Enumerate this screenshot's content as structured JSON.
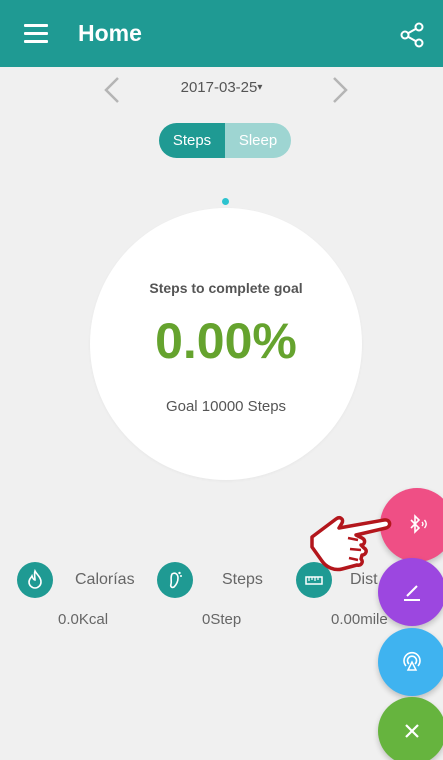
{
  "appbar": {
    "title": "Home",
    "menu_icon": "menu-icon",
    "share_icon": "share-icon"
  },
  "date": {
    "value": "2017-03-25",
    "caret": "▾"
  },
  "toggle": {
    "steps_label": "Steps",
    "sleep_label": "Sleep",
    "selected": "Steps"
  },
  "goal": {
    "title": "Steps to complete goal",
    "percent": "0.00%",
    "goal_text": "Goal 10000 Steps",
    "progress": 0
  },
  "stats": {
    "calories": {
      "label": "Calorías",
      "value": "0.0Kcal",
      "icon": "flame-icon"
    },
    "steps": {
      "label": "Steps",
      "value": "0Step",
      "icon": "footprint-icon"
    },
    "distance": {
      "label": "Dist",
      "value": "0.00mile",
      "icon": "ruler-icon"
    }
  },
  "fabs": [
    {
      "name": "bluetooth",
      "icon": "bluetooth-icon",
      "color": "#ef4f85"
    },
    {
      "name": "edit",
      "icon": "pencil-icon",
      "color": "#9c47e0"
    },
    {
      "name": "signal",
      "icon": "signal-icon",
      "color": "#3fb3f0"
    },
    {
      "name": "close",
      "icon": "close-icon",
      "color": "#66b43e"
    }
  ],
  "colors": {
    "primary": "#1f9a93",
    "primary_light": "#9ed5d2",
    "percent_green": "#65a32e",
    "background": "#f0f0f0"
  }
}
